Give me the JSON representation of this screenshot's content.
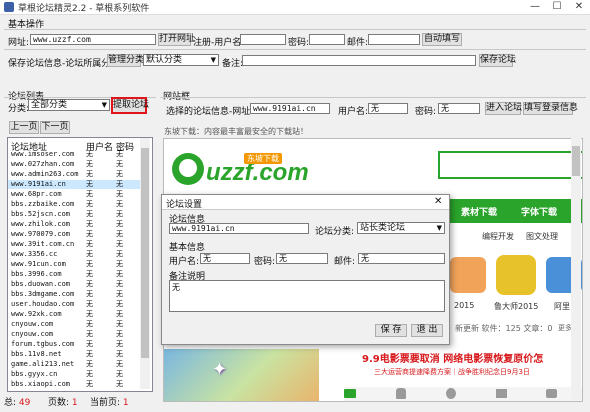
{
  "window": {
    "title": "草根论坛精灵2.2 - 草根系列软件",
    "minimize": "—",
    "maximize": "☐",
    "close": "✕"
  },
  "basic": {
    "section_title": "基本操作",
    "url_label": "网址:",
    "url_value": "www.uzzf.com",
    "open_url": "打开网址",
    "register_username_label": "注册-用户名:",
    "password_label": "密码:",
    "email_label": "邮件:",
    "auto_fill": "自动填写",
    "save_info_label": "保存论坛信息-论坛所属分类:",
    "manage_category": "管理分类",
    "default_category": "默认分类",
    "remark_label": "备注:",
    "save_forum": "保存论坛"
  },
  "forum_list": {
    "section_title": "论坛列表",
    "category_label": "分类:",
    "category_value": "全部分类",
    "extract_button": "提取论坛",
    "prev_page": "上一页",
    "next_page": "下一页",
    "columns": [
      "论坛地址",
      "用户名",
      "密码"
    ],
    "rows": [
      [
        "www.imsoser.com",
        "无",
        "无"
      ],
      [
        "www.027zhan.com",
        "无",
        "无"
      ],
      [
        "www.admin263.com",
        "无",
        "无"
      ],
      [
        "www.9191ai.cn",
        "无",
        "无"
      ],
      [
        "www.68pr.com",
        "无",
        "无"
      ],
      [
        "bbs.zzbaike.com",
        "无",
        "无"
      ],
      [
        "bbs.52jscn.com",
        "无",
        "无"
      ],
      [
        "www.zhilok.com",
        "无",
        "无"
      ],
      [
        "www.970079.com",
        "无",
        "无"
      ],
      [
        "www.39it.com.cn",
        "无",
        "无"
      ],
      [
        "www.3356.cc",
        "无",
        "无"
      ],
      [
        "www.91cun.com",
        "无",
        "无"
      ],
      [
        "bbs.3996.com",
        "无",
        "无"
      ],
      [
        "bbs.duowan.com",
        "无",
        "无"
      ],
      [
        "bbs.3dmgame.com",
        "无",
        "无"
      ],
      [
        "user.houdao.com",
        "无",
        "无"
      ],
      [
        "www.92xk.com",
        "无",
        "无"
      ],
      [
        "cnyouw.com",
        "无",
        "无"
      ],
      [
        "cnyouw.com",
        "无",
        "无"
      ],
      [
        "forum.tgbus.com",
        "无",
        "无"
      ],
      [
        "bbs.11v8.net",
        "无",
        "无"
      ],
      [
        "game.ali213.net",
        "无",
        "无"
      ],
      [
        "bbs.gyyx.cn",
        "无",
        "无"
      ],
      [
        "bbs.xiaopi.com",
        "无",
        "无"
      ]
    ],
    "selected_row": 3,
    "total_label": "总:",
    "total_value": "49",
    "pages_label": "页数:",
    "pages_value": "1",
    "current_label": "当前页:",
    "current_value": "1"
  },
  "site": {
    "section_title": "网站框",
    "selected_url_label": "选择的论坛信息-网址:",
    "selected_url_value": "www.9191ai.cn",
    "username_label": "用户名:",
    "username_value": "无",
    "password_label": "密码:",
    "password_value": "无",
    "enter_forum": "进入论坛",
    "fill_login": "填写登录信息"
  },
  "browser": {
    "slogan": "东坡下载：内容最丰富最安全的下载站！",
    "logo_text": "uzzf.com",
    "logo_badge": "东坡下载",
    "tab_material": "素材下载",
    "tab_font": "字体下载",
    "link_dev": "编程开发",
    "link_image": "图文处理",
    "app_2015": "2015",
    "app_mid": "鲁大师2015",
    "app_right": "阿里",
    "update_news": "新更新 软件：125 文章：0",
    "more": "更多»",
    "ad_red": "9.9电影票要取消 网络电影票恢复原价怎",
    "ad_sub": "三大运营商提速降费方案｜战争胜利纪念日9月3日",
    "colors": {
      "green": "#2aa42a",
      "red": "#d7191c",
      "orange": "#f39800"
    }
  },
  "dialog": {
    "title": "论坛设置",
    "close": "✕",
    "forum_info": "论坛信息",
    "url_value": "www.9191ai.cn",
    "category_label": "论坛分类:",
    "category_value": "站长类论坛",
    "basic_info": "基本信息",
    "username_label": "用户名:",
    "username_value": "无",
    "password_label": "密码:",
    "password_value": "无",
    "email_label": "邮件:",
    "email_value": "无",
    "remark_label": "备注说明",
    "remark_value": "无",
    "save": "保 存",
    "exit": "退 出"
  }
}
